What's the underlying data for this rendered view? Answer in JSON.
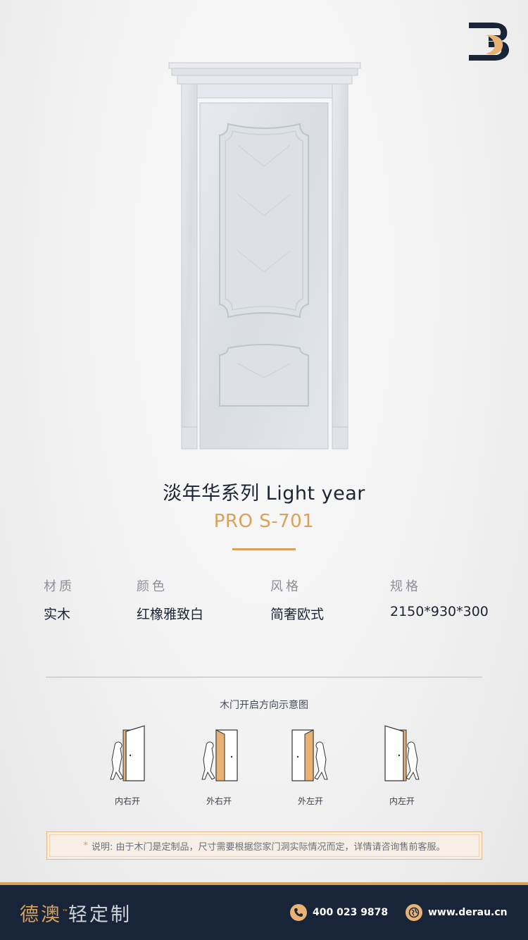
{
  "colors": {
    "accent": "#d9a25a",
    "navy": "#182437",
    "text": "#1d2433",
    "muted": "#8b8f97"
  },
  "brand_icon": "derau-b-logo",
  "product": {
    "series": "淡年华系列  Light year",
    "model": "PRO S-701"
  },
  "specs": [
    {
      "label": "材质",
      "value": "实木"
    },
    {
      "label": "颜色",
      "value": "红橡雅致白"
    },
    {
      "label": "风格",
      "value": "简奢欧式"
    },
    {
      "label": "规格",
      "value": "2150*930*300"
    }
  ],
  "diagram": {
    "title": "木门开启方向示意图",
    "items": [
      {
        "label": "内右开",
        "icon": "inward-right-door-icon"
      },
      {
        "label": "外右开",
        "icon": "outward-right-door-icon"
      },
      {
        "label": "外左开",
        "icon": "outward-left-door-icon"
      },
      {
        "label": "内左开",
        "icon": "inward-left-door-icon"
      }
    ]
  },
  "notice": {
    "marker": "*",
    "text": "说明: 由于木门是定制品，尺寸需要根据您家门洞实际情况而定，详情请咨询售前客服。"
  },
  "footer": {
    "brand_name": "德澳",
    "trademark": "™",
    "brand_tagline": "轻定制",
    "phone": "400 023 9878",
    "phone_icon": "phone-icon",
    "website": "www.derau.cn",
    "website_icon": "globe-icon"
  }
}
